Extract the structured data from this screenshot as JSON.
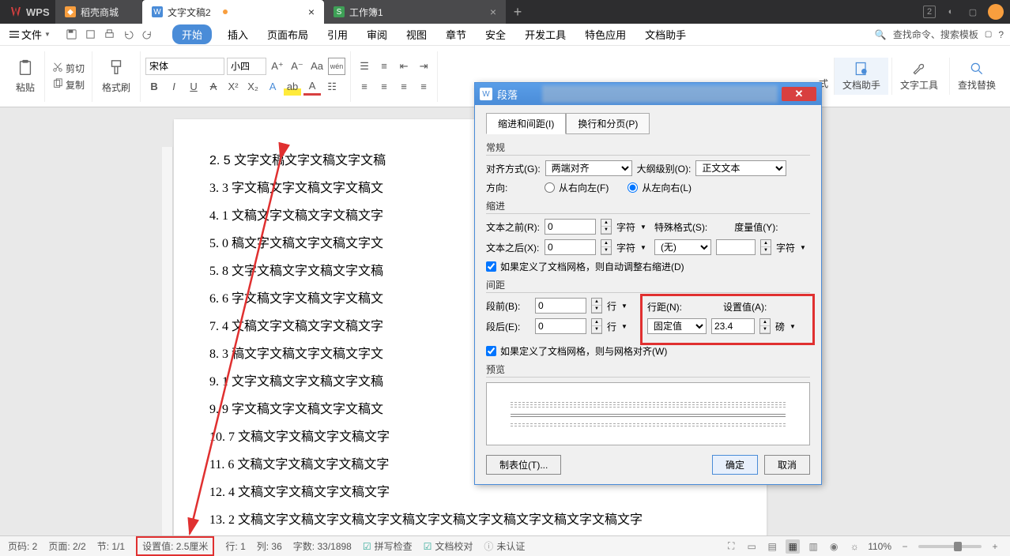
{
  "titlebar": {
    "logo": "WPS",
    "tabs": [
      {
        "label": "稻壳商城",
        "icon": "orange"
      },
      {
        "label": "文字文稿2",
        "icon": "blue",
        "active": true
      },
      {
        "label": "工作簿1",
        "icon": "green"
      }
    ],
    "badge": "2"
  },
  "menubar": {
    "file": "文件",
    "ribbon_tabs": [
      "开始",
      "插入",
      "页面布局",
      "引用",
      "审阅",
      "视图",
      "章节",
      "安全",
      "开发工具",
      "特色应用",
      "文档助手"
    ],
    "search_placeholder": "查找命令、搜索模板"
  },
  "ribbon": {
    "paste": "粘贴",
    "cut": "剪切",
    "copy": "复制",
    "format_painter": "格式刷",
    "font_name": "宋体",
    "font_size": "小四",
    "doc_assistant": "文档助手",
    "text_tools": "文字工具",
    "find_replace": "查找替换",
    "style_label": "式"
  },
  "doc_lines": [
    "2. 5 文字文稿文字文稿文字文稿",
    "3. 3 字文稿文字文稿文字文稿文",
    "4. 1 文稿文字文稿文字文稿文字",
    "5. 0 稿文字文稿文字文稿文字文",
    "5. 8 文字文稿文字文稿文字文稿",
    "6. 6 字文稿文字文稿文字文稿文",
    "7. 4 文稿文字文稿文字文稿文字",
    "8. 3 稿文字文稿文字文稿文字文",
    "9. 1 文字文稿文字文稿文字文稿",
    "9. 9 字文稿文字文稿文字文稿文",
    "10. 7 文稿文字文稿文字文稿文字",
    "11. 6 文稿文字文稿文字文稿文字",
    "12. 4 文稿文字文稿文字文稿文字",
    "13. 2 文稿文字文稿文字文稿文字文稿文字文稿文字文稿文字文稿文字文稿文字"
  ],
  "dialog": {
    "title": "段落",
    "tab1": "缩进和间距(I)",
    "tab2": "换行和分页(P)",
    "section_general": "常规",
    "align_label": "对齐方式(G):",
    "align_value": "两端对齐",
    "outline_label": "大纲级别(O):",
    "outline_value": "正文文本",
    "direction_label": "方向:",
    "dir_rtl": "从右向左(F)",
    "dir_ltr": "从左向右(L)",
    "section_indent": "缩进",
    "before_text": "文本之前(R):",
    "before_text_val": "0",
    "after_text": "文本之后(X):",
    "after_text_val": "0",
    "unit_char": "字符",
    "special_label": "特殊格式(S):",
    "special_value": "(无)",
    "measure_label": "度量值(Y):",
    "indent_check": "如果定义了文档网格，则自动调整右缩进(D)",
    "section_spacing": "间距",
    "before_para": "段前(B):",
    "before_para_val": "0",
    "after_para": "段后(E):",
    "after_para_val": "0",
    "unit_line": "行",
    "line_spacing": "行距(N):",
    "line_spacing_val": "固定值",
    "set_value": "设置值(A):",
    "set_value_val": "23.4",
    "unit_pt": "磅",
    "spacing_check": "如果定义了文档网格，则与网格对齐(W)",
    "section_preview": "预览",
    "btn_tabs": "制表位(T)...",
    "btn_ok": "确定",
    "btn_cancel": "取消"
  },
  "statusbar": {
    "page_no": "页码: 2",
    "page": "页面: 2/2",
    "section": "节: 1/1",
    "set_val": "设置值: 2.5厘米",
    "row": "行: 1",
    "col": "列: 36",
    "words": "字数: 33/1898",
    "spell": "拼写检查",
    "proof": "文档校对",
    "auth": "未认证",
    "zoom": "110%"
  }
}
